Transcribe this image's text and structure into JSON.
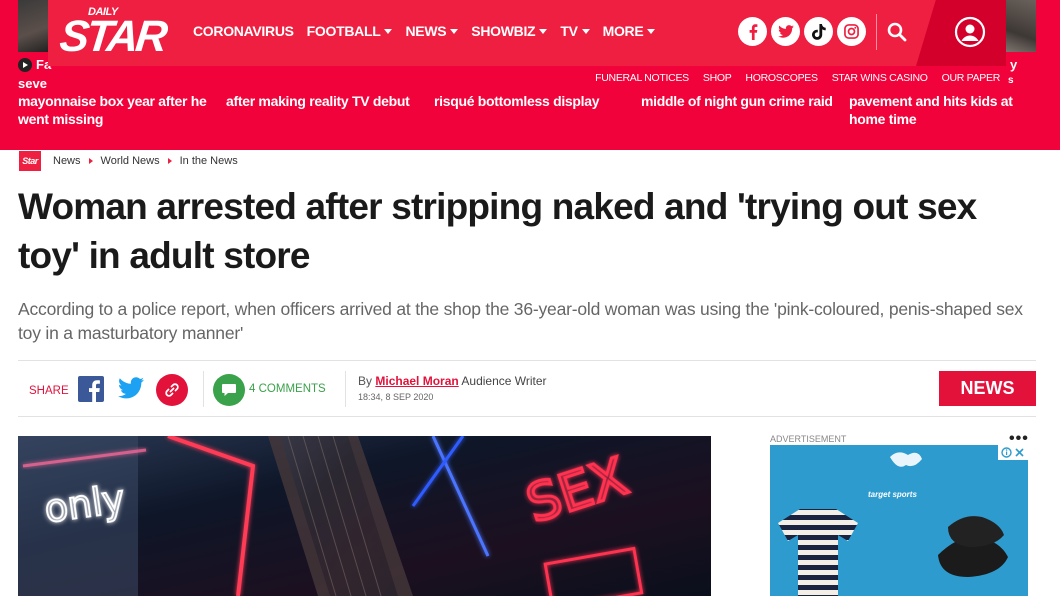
{
  "header": {
    "logo_small": "DAILY",
    "logo_big": "STAR",
    "nav": [
      {
        "label": "CORONAVIRUS",
        "dropdown": false
      },
      {
        "label": "FOOTBALL",
        "dropdown": true
      },
      {
        "label": "NEWS",
        "dropdown": true
      },
      {
        "label": "SHOWBIZ",
        "dropdown": true
      },
      {
        "label": "TV",
        "dropdown": true
      },
      {
        "label": "MORE",
        "dropdown": true
      }
    ],
    "socials": [
      "facebook-icon",
      "twitter-icon",
      "tiktok-icon",
      "instagram-icon"
    ],
    "subnav": [
      "FUNERAL NOTICES",
      "SHOP",
      "HOROSCOPES",
      "STAR WINS CASINO",
      "OUR PAPER"
    ]
  },
  "ticker": {
    "label": "Fa",
    "fragment_left": "seve",
    "fragment_right_1": "y",
    "fragment_right_2": "s",
    "stories": [
      "mayonnaise box year after he went missing",
      "after making reality TV debut",
      "risqué bottomless display",
      "middle of night gun crime raid",
      "pavement and hits kids at home time"
    ]
  },
  "breadcrumb": {
    "logo": "Star",
    "items": [
      "News",
      "World News",
      "In the News"
    ]
  },
  "article": {
    "headline": "Woman arrested after stripping naked and 'trying out sex toy' in adult store",
    "standfirst": "According to a police report, when officers arrived at the shop the 36-year-old woman was using the 'pink-coloured, penis-shaped sex toy in a masturbatory manner'",
    "share_label": "SHARE",
    "comments_count": "4",
    "comments_label": "COMMENTS",
    "byline_prefix": "By",
    "author": "Michael Moran",
    "author_role": "Audience Writer",
    "timestamp": "18:34, 8 SEP 2020",
    "section_badge": "NEWS"
  },
  "hero": {
    "neon_text_1": "only",
    "neon_text_2": "SEX"
  },
  "advert": {
    "label": "ADVERTISEMENT",
    "brand": "target sports"
  },
  "colors": {
    "brand_red": "#ee1f40",
    "band_red": "#f2023a",
    "accent_red": "#e2123b",
    "comment_green": "#3aa24a"
  }
}
